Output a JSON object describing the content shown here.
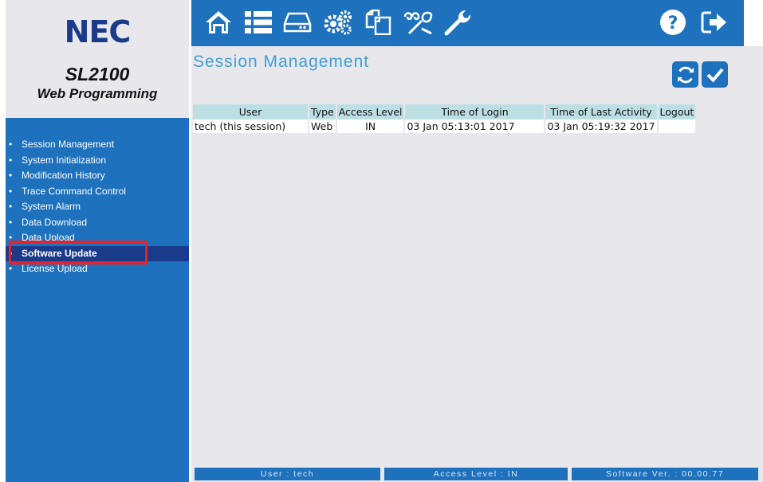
{
  "brand": {
    "logo": "NEC",
    "product": "SL2100",
    "subtitle": "Web Programming"
  },
  "toolbar": {
    "icons": [
      "home-icon",
      "list-icon",
      "drive-icon",
      "gears-icon",
      "copy-icon",
      "tools-icon",
      "wrench-icon",
      "help-icon",
      "logout-icon"
    ]
  },
  "sidebar": {
    "items": [
      {
        "label": "Session Management",
        "active": false
      },
      {
        "label": "System Initialization",
        "active": false
      },
      {
        "label": "Modification History",
        "active": false
      },
      {
        "label": "Trace Command Control",
        "active": false
      },
      {
        "label": "System Alarm",
        "active": false
      },
      {
        "label": "Data Download",
        "active": false
      },
      {
        "label": "Data Upload",
        "active": false
      },
      {
        "label": "Software Update",
        "active": true
      },
      {
        "label": "License Upload",
        "active": false
      }
    ],
    "bullet": "•"
  },
  "main": {
    "title": "Session Management",
    "actions": [
      "refresh-icon",
      "check-icon"
    ],
    "table": {
      "headers": [
        "User",
        "Type",
        "Access Level",
        "Time of Login",
        "Time of Last Activity",
        "Logout"
      ],
      "rows": [
        [
          "tech (this session)",
          "Web",
          "IN",
          "03 Jan 05:13:01 2017",
          "03 Jan 05:19:32 2017",
          ""
        ]
      ]
    }
  },
  "status": {
    "user": "User : tech",
    "access": "Access Level : IN",
    "version": "Software Ver. : 00.00.77"
  },
  "colors": {
    "accent": "#1e71bd",
    "active": "#1a3a8a",
    "title": "#3d9fd8",
    "header_bg": "#bcdfe4",
    "highlight": "#e8212a"
  }
}
